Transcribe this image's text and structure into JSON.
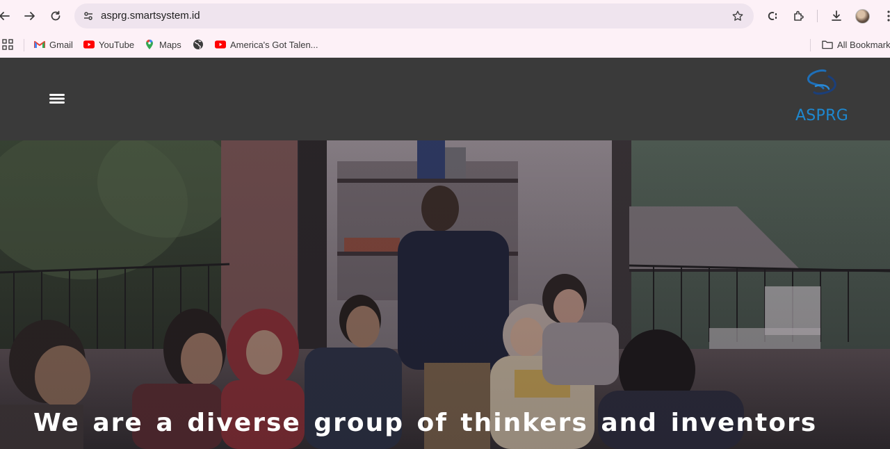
{
  "browser": {
    "url": "asprg.smartsystem.id",
    "nav_icons": [
      "back-arrow-icon",
      "forward-arrow-icon",
      "reload-icon"
    ],
    "toolbar_icons": [
      "site-settings-icon",
      "bookmark-star-icon",
      "extension-c-icon",
      "puzzle-extensions-icon",
      "download-icon",
      "profile-avatar",
      "more-vert-icon"
    ]
  },
  "bookmarks": {
    "items": [
      {
        "label": "Gmail",
        "icon": "gmail-icon"
      },
      {
        "label": "YouTube",
        "icon": "youtube-icon"
      },
      {
        "label": "Maps",
        "icon": "maps-pin-icon"
      },
      {
        "label": "",
        "icon": "globe-icon"
      },
      {
        "label": "America's Got Talen...",
        "icon": "youtube-icon"
      }
    ],
    "all_bookmarks_label": "All Bookmark"
  },
  "site": {
    "logo_text": "ASPRG",
    "hero_title": "We are a diverse group of thinkers and inventors"
  },
  "colors": {
    "browser_bg": "#fdf1f7",
    "omnibox_bg": "#efe4ee",
    "header_bg": "#3a3a3a",
    "logo_blue": "#1e88d0",
    "youtube_red": "#ff0000"
  }
}
